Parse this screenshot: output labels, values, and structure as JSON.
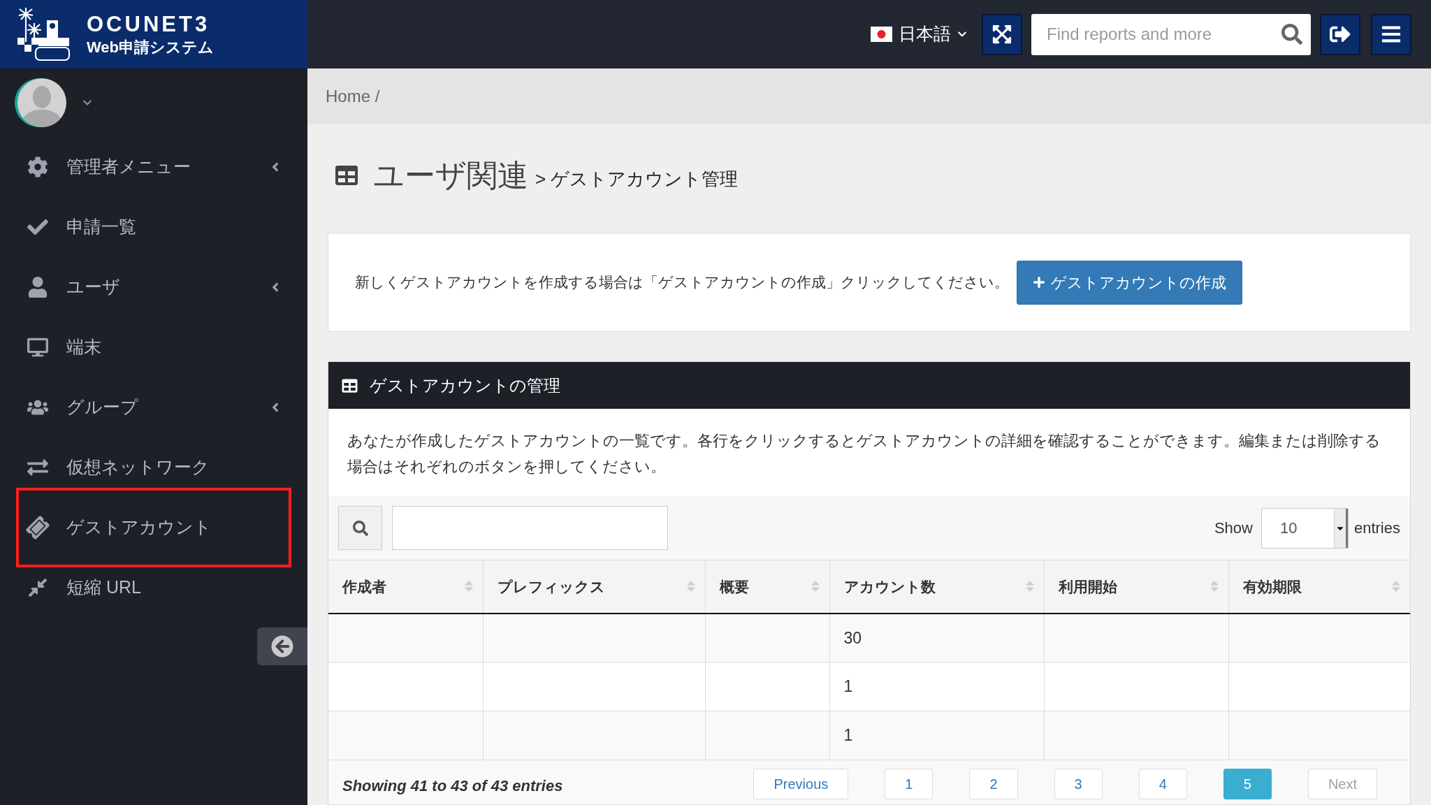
{
  "brand": {
    "title": "OCUNET3",
    "subtitle": "Web申請システム"
  },
  "topbar": {
    "language": "日本語",
    "search": {
      "placeholder": "Find reports and more"
    }
  },
  "sidebar": {
    "items": [
      {
        "label": "管理者メニュー",
        "submenu": true,
        "highlighted": false
      },
      {
        "label": "申請一覧",
        "submenu": false,
        "highlighted": false
      },
      {
        "label": "ユーザ",
        "submenu": true,
        "highlighted": false
      },
      {
        "label": "端末",
        "submenu": false,
        "highlighted": false
      },
      {
        "label": "グループ",
        "submenu": true,
        "highlighted": false
      },
      {
        "label": "仮想ネットワーク",
        "submenu": false,
        "highlighted": false
      },
      {
        "label": "ゲストアカウント",
        "submenu": false,
        "highlighted": true
      },
      {
        "label": "短縮 URL",
        "submenu": false,
        "highlighted": false
      }
    ]
  },
  "breadcrumb": "Home /",
  "page_title": {
    "title": "ユーザ関連",
    "subtitle": "> ゲストアカウント管理"
  },
  "notice": {
    "text": "新しくゲストアカウントを作成する場合は「ゲストアカウントの作成」クリックしてください。",
    "button": "ゲストアカウントの作成"
  },
  "panel": {
    "title": "ゲストアカウントの管理",
    "description": "あなたが作成したゲストアカウントの一覧です。各行をクリックするとゲストアカウントの詳細を確認することができます。編集または削除する場合はそれぞれのボタンを押してください。",
    "page_length": {
      "label": "Show",
      "value": "10",
      "suffix": "entries"
    },
    "table": {
      "columns": [
        "作成者",
        "プレフィックス",
        "概要",
        "アカウント数",
        "利用開始",
        "有効期限"
      ],
      "rows": [
        {
          "accounts": "30"
        },
        {
          "accounts": "1"
        },
        {
          "accounts": "1"
        }
      ]
    },
    "info": "Showing 41 to 43 of 43 entries",
    "pagination": [
      {
        "label": "Previous",
        "selected": false,
        "disabled": false
      },
      {
        "label": "1",
        "selected": false,
        "disabled": false
      },
      {
        "label": "2",
        "selected": false,
        "disabled": false
      },
      {
        "label": "3",
        "selected": false,
        "disabled": false
      },
      {
        "label": "4",
        "selected": false,
        "disabled": false
      },
      {
        "label": "5",
        "selected": true,
        "disabled": false
      },
      {
        "label": "Next",
        "selected": false,
        "disabled": true
      }
    ]
  }
}
